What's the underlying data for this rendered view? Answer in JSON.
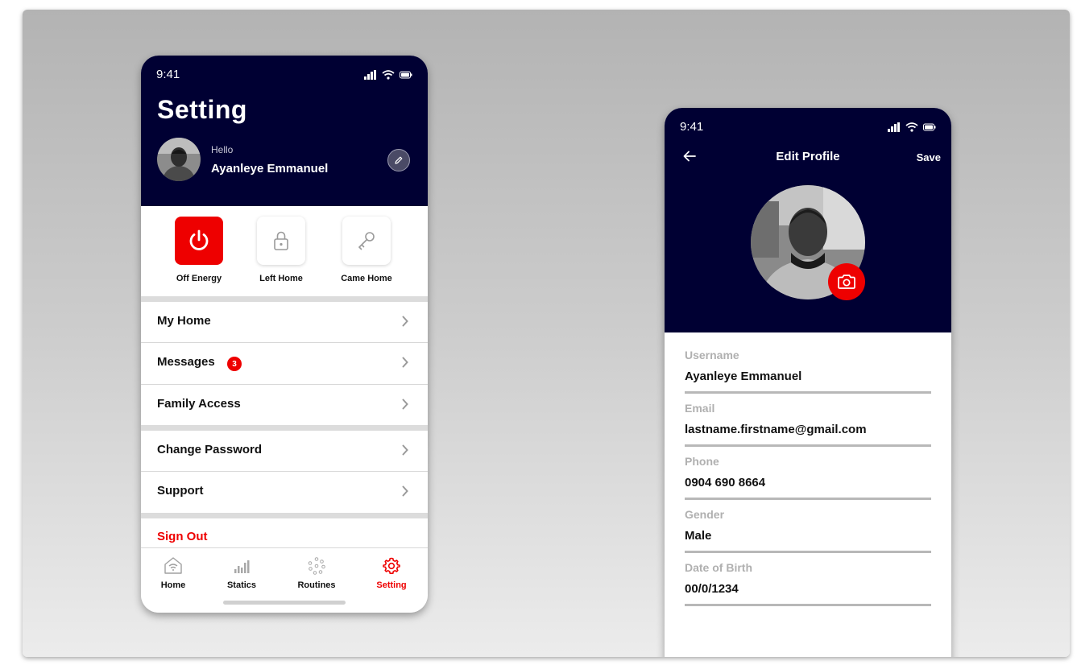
{
  "setting_screen": {
    "status_time": "9:41",
    "title": "Setting",
    "greeting": "Hello",
    "user_name": "Ayanleye Emmanuel",
    "quick_actions": [
      {
        "label": "Off Energy",
        "icon": "power-icon",
        "active": true
      },
      {
        "label": "Left Home",
        "icon": "lock-icon",
        "active": false
      },
      {
        "label": "Came Home",
        "icon": "key-icon",
        "active": false
      }
    ],
    "menu": {
      "my_home": "My Home",
      "messages": "Messages",
      "messages_badge": "3",
      "family_access": "Family Access",
      "change_password": "Change Password",
      "support": "Support",
      "sign_out": "Sign Out"
    },
    "tabs": [
      {
        "label": "Home",
        "icon": "home-wifi-icon"
      },
      {
        "label": "Statics",
        "icon": "bar-chart-icon"
      },
      {
        "label": "Routines",
        "icon": "dots-circle-icon"
      },
      {
        "label": "Setting",
        "icon": "gear-icon",
        "active": true
      }
    ]
  },
  "edit_profile_screen": {
    "status_time": "9:41",
    "title": "Edit Profile",
    "save_label": "Save",
    "fields": [
      {
        "label": "Username",
        "value": "Ayanleye Emmanuel"
      },
      {
        "label": "Email",
        "value": "lastname.firstname@gmail.com"
      },
      {
        "label": "Phone",
        "value": "0904 690 8664"
      },
      {
        "label": "Gender",
        "value": "Male"
      },
      {
        "label": "Date of Birth",
        "value": "00/0/1234"
      }
    ]
  },
  "colors": {
    "header_navy": "#000033",
    "accent_red": "#ee0000",
    "divider": "#dcdcdc"
  }
}
